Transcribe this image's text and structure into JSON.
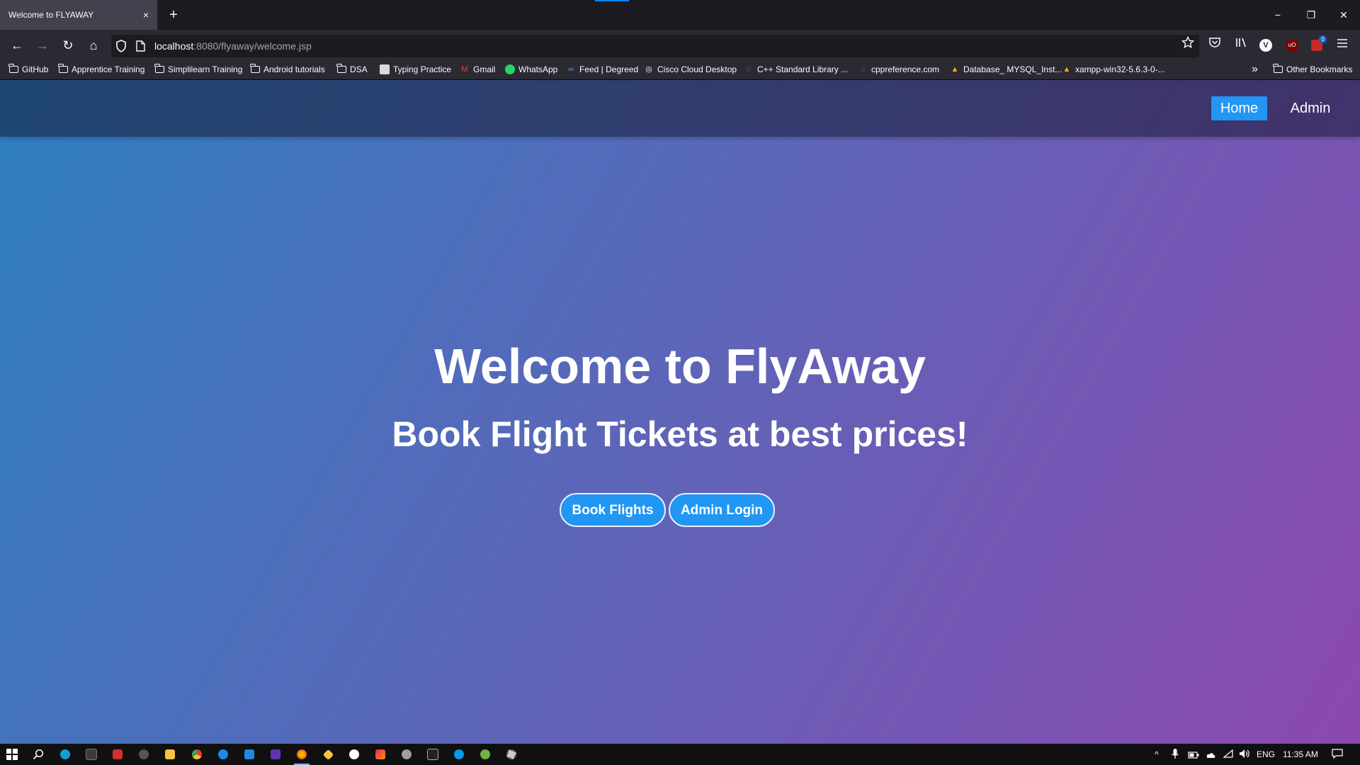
{
  "browser": {
    "tab_title": "Welcome to FLYAWAY",
    "tab_close_glyph": "×",
    "new_tab_glyph": "+",
    "url_host": "localhost",
    "url_rest": ":8080/flyaway/welcome.jsp",
    "window_controls": {
      "minimize": "−",
      "restore": "❐",
      "close": "✕"
    },
    "nav": {
      "back": "←",
      "forward": "→",
      "reload": "↻",
      "home": "⌂"
    },
    "toolbar_icons": [
      "star-icon",
      "pocket-icon",
      "library-icon",
      "vpn-icon",
      "ublock-icon",
      "extension-icon",
      "menu-icon"
    ]
  },
  "bookmarks": [
    {
      "label": "GitHub",
      "icon": "folder-icon"
    },
    {
      "label": "Apprentice Training",
      "icon": "folder-icon"
    },
    {
      "label": "Simplilearn Training",
      "icon": "folder-icon"
    },
    {
      "label": "Android tutorials",
      "icon": "folder-icon"
    },
    {
      "label": "DSA",
      "icon": "folder-icon"
    },
    {
      "label": "Typing Practice",
      "icon": "typing-icon"
    },
    {
      "label": "Gmail",
      "icon": "gmail-icon"
    },
    {
      "label": "WhatsApp",
      "icon": "whatsapp-icon"
    },
    {
      "label": "Feed | Degreed",
      "icon": "degreed-icon"
    },
    {
      "label": "Cisco Cloud Desktop",
      "icon": "cisco-icon"
    },
    {
      "label": "C++ Standard Library ...",
      "icon": "cpp-icon"
    },
    {
      "label": "cppreference.com",
      "icon": "cpp-icon"
    },
    {
      "label": "Database_ MYSQL_Inst...",
      "icon": "drive-icon"
    },
    {
      "label": "xampp-win32-5.6.3-0-...",
      "icon": "drive-icon"
    }
  ],
  "bookmarks_overflow": "»",
  "other_bookmarks": "Other Bookmarks",
  "site": {
    "nav_home": "Home",
    "nav_admin": "Admin",
    "hero_title": "Welcome to FlyAway",
    "hero_subtitle": "Book Flight Tickets at best prices!",
    "btn_book": "Book Flights",
    "btn_admin": "Admin Login"
  },
  "taskbar": {
    "language": "ENG",
    "time": "11:35 AM"
  },
  "colors": {
    "accent": "#2196f3",
    "gradient_start": "#2d7fc1",
    "gradient_end": "#8c48b0"
  }
}
